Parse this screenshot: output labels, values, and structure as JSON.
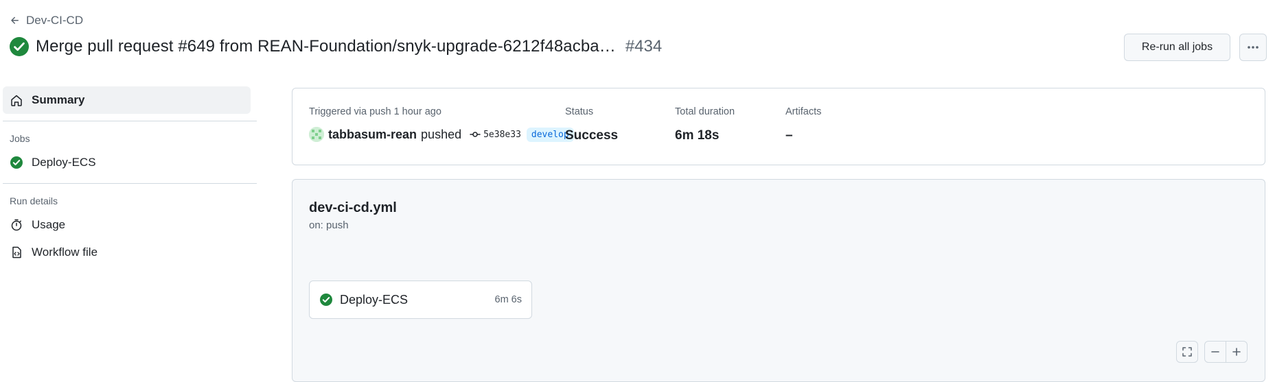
{
  "breadcrumb": {
    "back_label": "Dev-CI-CD"
  },
  "header": {
    "title": "Merge pull request #649 from REAN-Foundation/snyk-upgrade-6212f48acba…",
    "run_number": "#434",
    "rerun_label": "Re-run all jobs"
  },
  "sidebar": {
    "summary_label": "Summary",
    "jobs_heading": "Jobs",
    "jobs": [
      {
        "label": "Deploy-ECS"
      }
    ],
    "run_details_heading": "Run details",
    "usage_label": "Usage",
    "workflow_file_label": "Workflow file"
  },
  "summary": {
    "trigger_label": "Triggered via push 1 hour ago",
    "actor": "tabbasum-rean",
    "action": "pushed",
    "commit": "5e38e33",
    "branch": "develop",
    "status_label": "Status",
    "status_value": "Success",
    "duration_label": "Total duration",
    "duration_value": "6m 18s",
    "artifacts_label": "Artifacts",
    "artifacts_value": "–"
  },
  "workflow": {
    "file_name": "dev-ci-cd.yml",
    "trigger": "on: push",
    "jobs": [
      {
        "name": "Deploy-ECS",
        "duration": "6m 6s"
      }
    ]
  },
  "colors": {
    "success": "#1f883d",
    "accent": "#0969da",
    "muted": "#59636e",
    "border": "#d1d9e0"
  }
}
